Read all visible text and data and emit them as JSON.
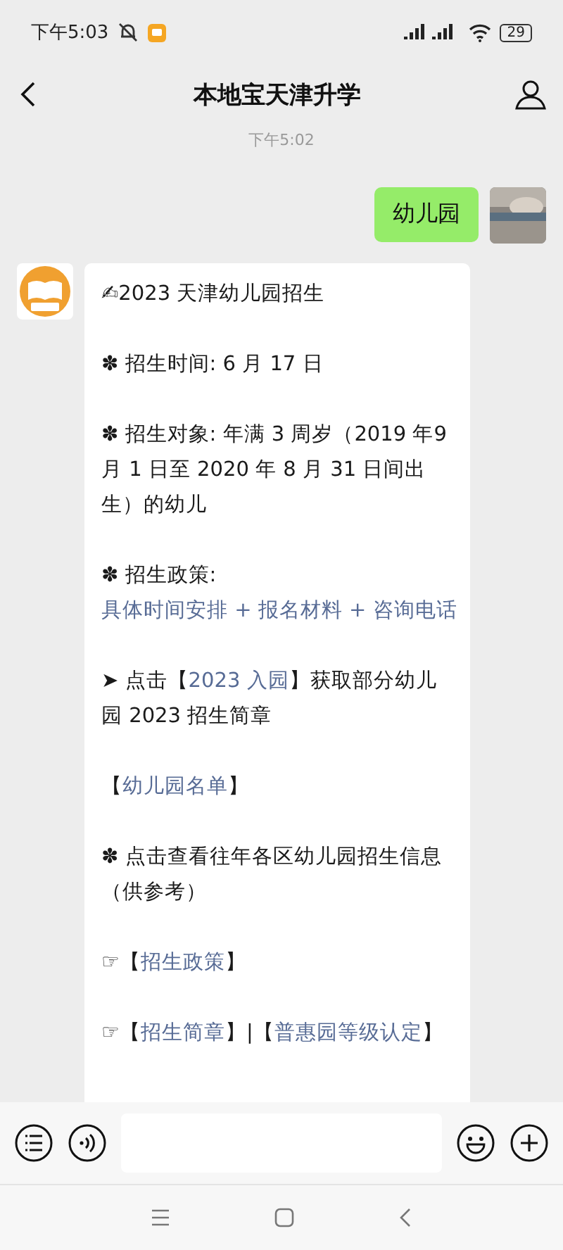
{
  "status_bar": {
    "time": "下午5:03",
    "battery": "29"
  },
  "header": {
    "title": "本地宝天津升学"
  },
  "timestamp": "下午5:02",
  "sent_message": {
    "text": "幼儿园"
  },
  "received_message": {
    "paragraphs": [
      [
        {
          "kind": "text",
          "text": "✍2023 天津幼儿园招生"
        }
      ],
      [
        {
          "kind": "text",
          "text": "✽ 招生时间: 6 月 17 日"
        }
      ],
      [
        {
          "kind": "text",
          "text": "✽ 招生对象: 年满 3 周岁（2019 年9 月 1 日至 2020 年 8 月 31 日间出生）的幼儿"
        }
      ],
      [
        {
          "kind": "text",
          "text": "✽ 招生政策: "
        },
        {
          "kind": "link",
          "text": "具体时间安排"
        },
        {
          "kind": "link",
          "text": " + "
        },
        {
          "kind": "link",
          "text": "报名材料"
        },
        {
          "kind": "link",
          "text": " + "
        },
        {
          "kind": "link",
          "text": "咨询电话"
        }
      ],
      [
        {
          "kind": "text",
          "text": "➤ 点击【"
        },
        {
          "kind": "link",
          "text": "2023 入园"
        },
        {
          "kind": "text",
          "text": "】获取部分幼儿园 2023 招生简章"
        }
      ],
      [
        {
          "kind": "text",
          "text": "【"
        },
        {
          "kind": "link",
          "text": "幼儿园名单"
        },
        {
          "kind": "text",
          "text": "】"
        }
      ],
      [
        {
          "kind": "text",
          "text": "✽ 点击查看往年各区幼儿园招生信息（供参考）"
        }
      ],
      [
        {
          "kind": "text",
          "text": "☞【"
        },
        {
          "kind": "link",
          "text": "招生政策"
        },
        {
          "kind": "text",
          "text": "】"
        }
      ],
      [
        {
          "kind": "text",
          "text": "☞【"
        },
        {
          "kind": "link",
          "text": "招生简章"
        },
        {
          "kind": "text",
          "text": "】|【"
        },
        {
          "kind": "link",
          "text": "普惠园等级认定"
        },
        {
          "kind": "text",
          "text": "】"
        }
      ]
    ]
  }
}
